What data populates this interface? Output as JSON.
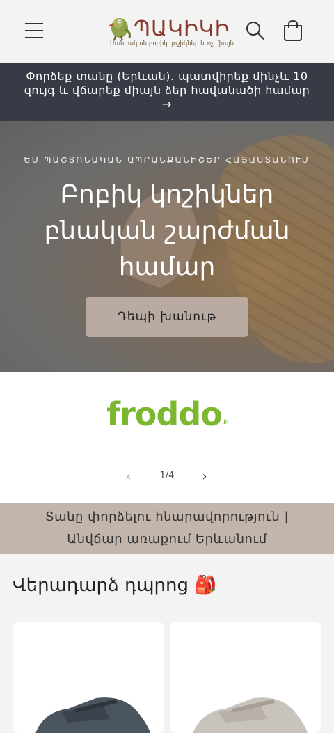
{
  "header": {
    "logo_text": "ՊԱԿԻԿԻ",
    "logo_tagline": "Մանկական բոբիկ կոշիկներ և ոչ միայն"
  },
  "announcement": {
    "text": "Փորձեք տանը (Երևան). պատվիրեք մինչև 10 զույգ և վճարեք միայն ձեր հավանածի համար",
    "arrow": "→"
  },
  "hero": {
    "eyebrow": "ԵՄ ՊԱՇՏՈՆԱԿԱՆ ԱՊՐԱՆՔԱՆԻՇԵՐ ՀԱՅԱՍՏԱՆՈՒՄ",
    "title": "Բոբիկ կոշիկներ բնական շարժման համար",
    "button_label": "Դեպի խանութ"
  },
  "slider": {
    "brand": "froddo",
    "registered_mark": "®",
    "prev": "‹",
    "next": "›",
    "counter": "1/4"
  },
  "delivery_banner": {
    "line1": "Տանը փորձելու հնարավորություն |",
    "line2": "Անվճար առաքում Երևանում"
  },
  "section": {
    "title": "Վերադարձ դպրոց 🎒"
  },
  "colors": {
    "announce_bg": "#363b46",
    "brand_green": "#7cb82f",
    "button_bg": "#b9aba1",
    "delivery_bg": "#c2b5ab"
  }
}
